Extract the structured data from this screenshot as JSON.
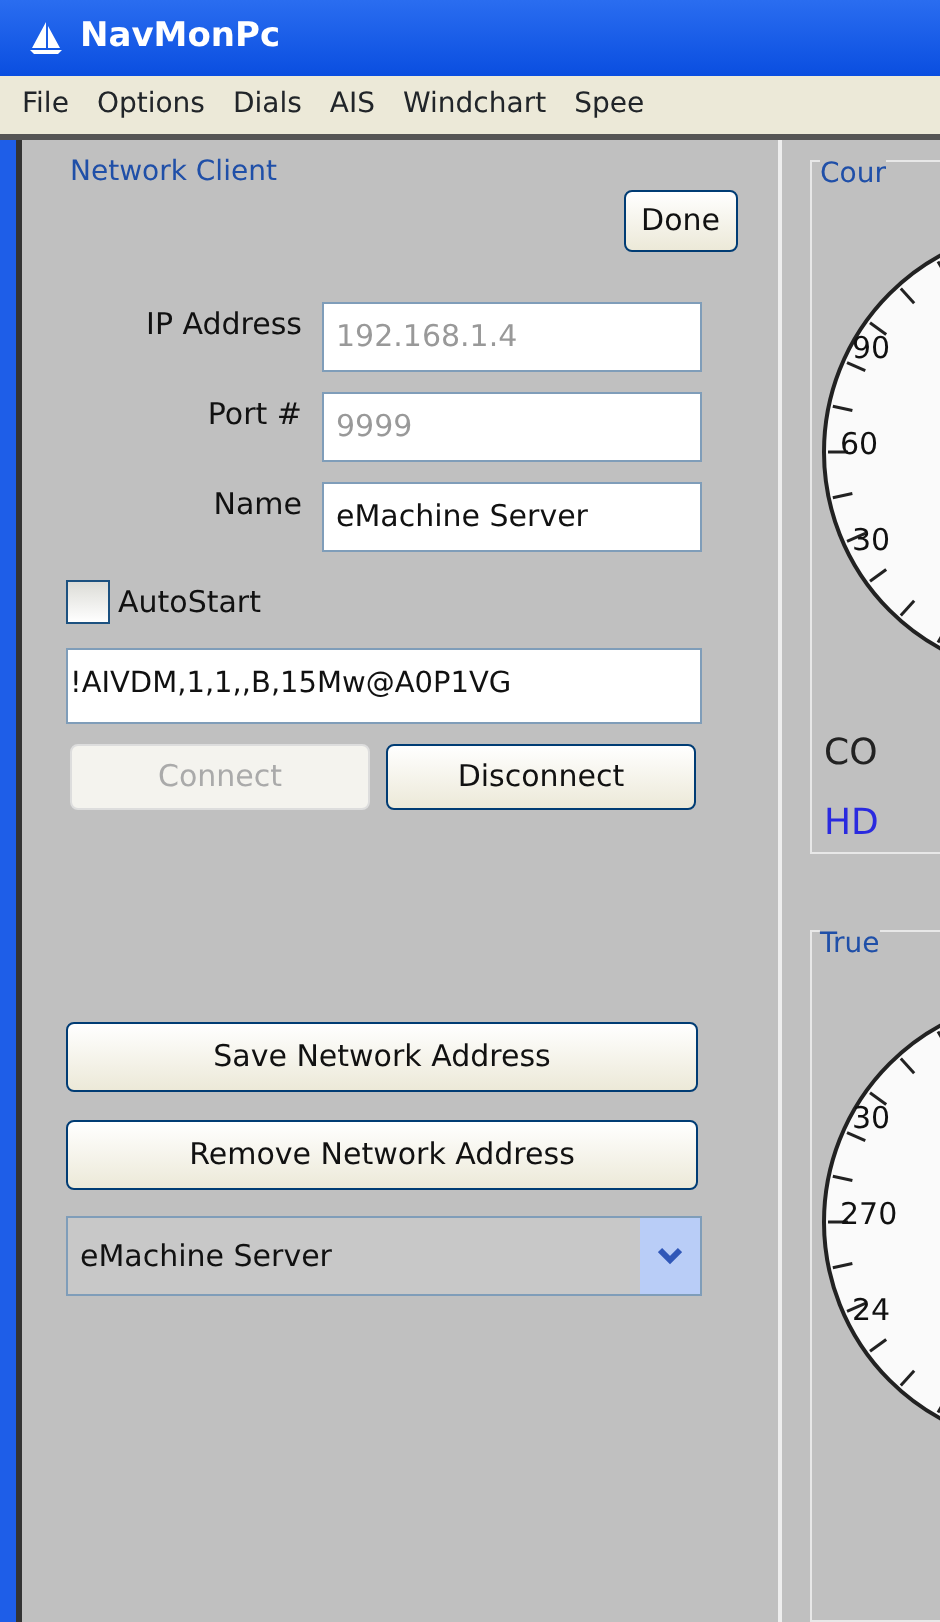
{
  "window": {
    "title": "NavMonPc"
  },
  "menu": [
    {
      "label": "File"
    },
    {
      "label": "Options"
    },
    {
      "label": "Dials"
    },
    {
      "label": "AIS"
    },
    {
      "label": "Windchart"
    },
    {
      "label": "Spee"
    }
  ],
  "network_client": {
    "title": "Network Client",
    "done": "Done",
    "fields": [
      {
        "label": "IP Address",
        "value": "192.168.1.4",
        "disabled": true
      },
      {
        "label": "Port #",
        "value": "9999",
        "disabled": true
      },
      {
        "label": "Name",
        "value": "eMachine Server",
        "disabled": false
      }
    ],
    "autostart": {
      "label": "AutoStart",
      "checked": false
    },
    "sentence": "!AIVDM,1,1,,B,15Mw@A0P1VG",
    "buttons": [
      {
        "label": "Connect",
        "disabled": true
      },
      {
        "label": "Disconnect",
        "disabled": false
      }
    ],
    "save": "Save Network Address",
    "remove": "Remove Network Address",
    "dropdown": {
      "value": "eMachine Server"
    }
  },
  "dials": [
    {
      "title": "Cour",
      "scale": [
        "90",
        "60",
        "30"
      ],
      "readings": [
        {
          "text": "CO",
          "kind": "plain"
        },
        {
          "text": "HD",
          "kind": "accent"
        }
      ]
    },
    {
      "title": "True",
      "scale": [
        "30",
        "270",
        "24"
      ]
    }
  ]
}
